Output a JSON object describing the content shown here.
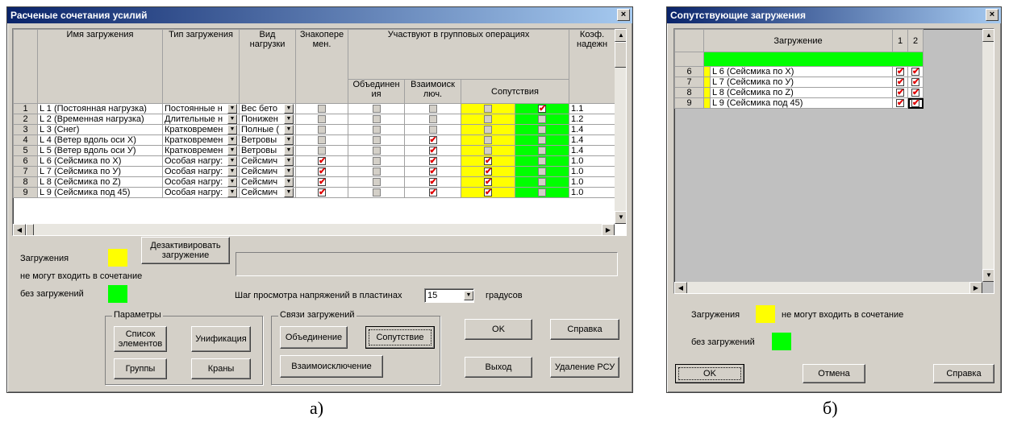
{
  "left": {
    "title": "Расченые сочетания усилий",
    "close": "×",
    "headers": {
      "name": "Имя загружения",
      "type": "Тип загружения",
      "vid": "Вид нагрузки",
      "sign": "Знакопере мен.",
      "group": "Участвуют в групповых операциях",
      "union": "Объединен ия",
      "mutex": "Взаимоиск люч.",
      "accomp": "Сопутствия",
      "coef": "Коэф. надежн"
    },
    "rows": [
      {
        "n": "1",
        "name": "L 1 (Постоянная нагрузка)",
        "type": "Постоянные н",
        "vid": "Вес бето",
        "sign": false,
        "union": false,
        "mutex": false,
        "s1": false,
        "s2": true,
        "coef": "1.1"
      },
      {
        "n": "2",
        "name": "L 2 (Временная нагрузка)",
        "type": "Длительные н",
        "vid": "Понижен",
        "sign": false,
        "union": false,
        "mutex": false,
        "s1": false,
        "s2": false,
        "coef": "1.2"
      },
      {
        "n": "3",
        "name": "L 3 (Снег)",
        "type": "Кратковремен",
        "vid": "Полные (",
        "sign": false,
        "union": false,
        "mutex": false,
        "s1": false,
        "s2": false,
        "coef": "1.4"
      },
      {
        "n": "4",
        "name": "L 4 (Ветер вдоль оси X)",
        "type": "Кратковремен",
        "vid": "Ветровы",
        "sign": false,
        "union": false,
        "mutex": true,
        "s1": false,
        "s2": false,
        "coef": "1.4"
      },
      {
        "n": "5",
        "name": "L 5 (Ветер вдоль оси У)",
        "type": "Кратковремен",
        "vid": "Ветровы",
        "sign": false,
        "union": false,
        "mutex": true,
        "s1": false,
        "s2": false,
        "coef": "1.4"
      },
      {
        "n": "6",
        "name": "L 6 (Сейсмика по X)",
        "type": "Особая нагру:",
        "vid": "Сейсмич",
        "sign": true,
        "union": false,
        "mutex": true,
        "s1": true,
        "s2": false,
        "coef": "1.0"
      },
      {
        "n": "7",
        "name": "L 7 (Сейсмика по У)",
        "type": "Особая нагру:",
        "vid": "Сейсмич",
        "sign": true,
        "union": false,
        "mutex": true,
        "s1": true,
        "s2": false,
        "coef": "1.0"
      },
      {
        "n": "8",
        "name": "L 8 (Сейсмика по Z)",
        "type": "Особая нагру:",
        "vid": "Сейсмич",
        "sign": true,
        "union": false,
        "mutex": true,
        "s1": true,
        "s2": false,
        "coef": "1.0"
      },
      {
        "n": "9",
        "name": "L 9 (Сейсмика под 45)",
        "type": "Особая нагру:",
        "vid": "Сейсмич",
        "sign": true,
        "union": false,
        "mutex": true,
        "s1": true,
        "s2": false,
        "coef": "1.0"
      }
    ],
    "deactivate": "Дезактивировать загружение",
    "legend1": "Загружения",
    "legend2": "не могут входить в сочетание",
    "legend3": "без загружений",
    "step_label": "Шаг просмотра напряжений в пластинах",
    "step_value": "15",
    "step_unit": "градусов",
    "params_title": "Параметры",
    "btn_list": "Список элементов",
    "btn_unif": "Унификация",
    "btn_groups": "Группы",
    "btn_cranes": "Краны",
    "links_title": "Связи загружений",
    "btn_union": "Объединение",
    "btn_accomp": "Сопутствие",
    "btn_mutex": "Взаимоисключение",
    "btn_ok": "OK",
    "btn_help": "Справка",
    "btn_exit": "Выход",
    "btn_del": "Удаление РСУ",
    "caption": "а)"
  },
  "right": {
    "title": "Сопутствующие загружения",
    "close": "×",
    "col_load": "Загружение",
    "col_1": "1",
    "col_2": "2",
    "rows": [
      {
        "n": "6",
        "name": "L 6 (Сейсмика по X)",
        "a": true,
        "b": true
      },
      {
        "n": "7",
        "name": "L 7 (Сейсмика по У)",
        "a": true,
        "b": true
      },
      {
        "n": "8",
        "name": "L 8 (Сейсмика по Z)",
        "a": true,
        "b": true
      },
      {
        "n": "9",
        "name": "L 9 (Сейсмика под 45)",
        "a": true,
        "b": true
      }
    ],
    "legend1": "Загружения",
    "legend2": "не могут входить в сочетание",
    "legend3": "без загружений",
    "btn_ok": "OK",
    "btn_cancel": "Отмена",
    "btn_help": "Справка",
    "caption": "б)"
  },
  "colors": {
    "yellow": "#ffff00",
    "green": "#00ff00",
    "title": "#0a246a"
  }
}
